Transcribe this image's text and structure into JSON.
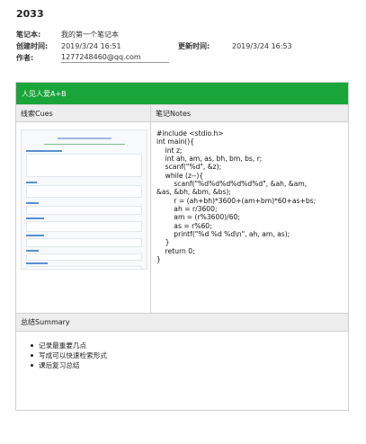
{
  "page": {
    "title": "2033"
  },
  "meta": {
    "notebook_label": "笔记本:",
    "notebook_value": "我的第一个笔记本",
    "created_label": "创建时间:",
    "created_value": "2019/3/24 16:51",
    "updated_label": "更新时间:",
    "updated_value": "2019/3/24 16:53",
    "author_label": "作者:",
    "author_value": "1277248460@qq.com"
  },
  "cornell": {
    "topic": "人见人爱A+B",
    "cues_header": "线索Cues",
    "notes_header": "笔记Notes",
    "summary_header": "总结Summary",
    "code_lines": [
      "#include <stdio.h>",
      "int main(){",
      "    int z;",
      "    int ah, am, as, bh, bm, bs, r;",
      "    scanf(\"%d\", &z);",
      "    while (z--){",
      "        scanf(\"%d%d%d%d%d%d\", &ah, &am,",
      "&as, &bh, &bm, &bs);",
      "        r = (ah+bh)*3600+(am+bm)*60+as+bs;",
      "        ah = r/3600;",
      "        am = (r%3600)/60;",
      "        as = r%60;",
      "        printf(\"%d %d %d\\n\", ah, am, as);",
      "    }",
      "    return 0;",
      "}"
    ],
    "summary_items": [
      "记录最重要几点",
      "写成可以快速检索形式",
      "课后复习总结"
    ]
  }
}
